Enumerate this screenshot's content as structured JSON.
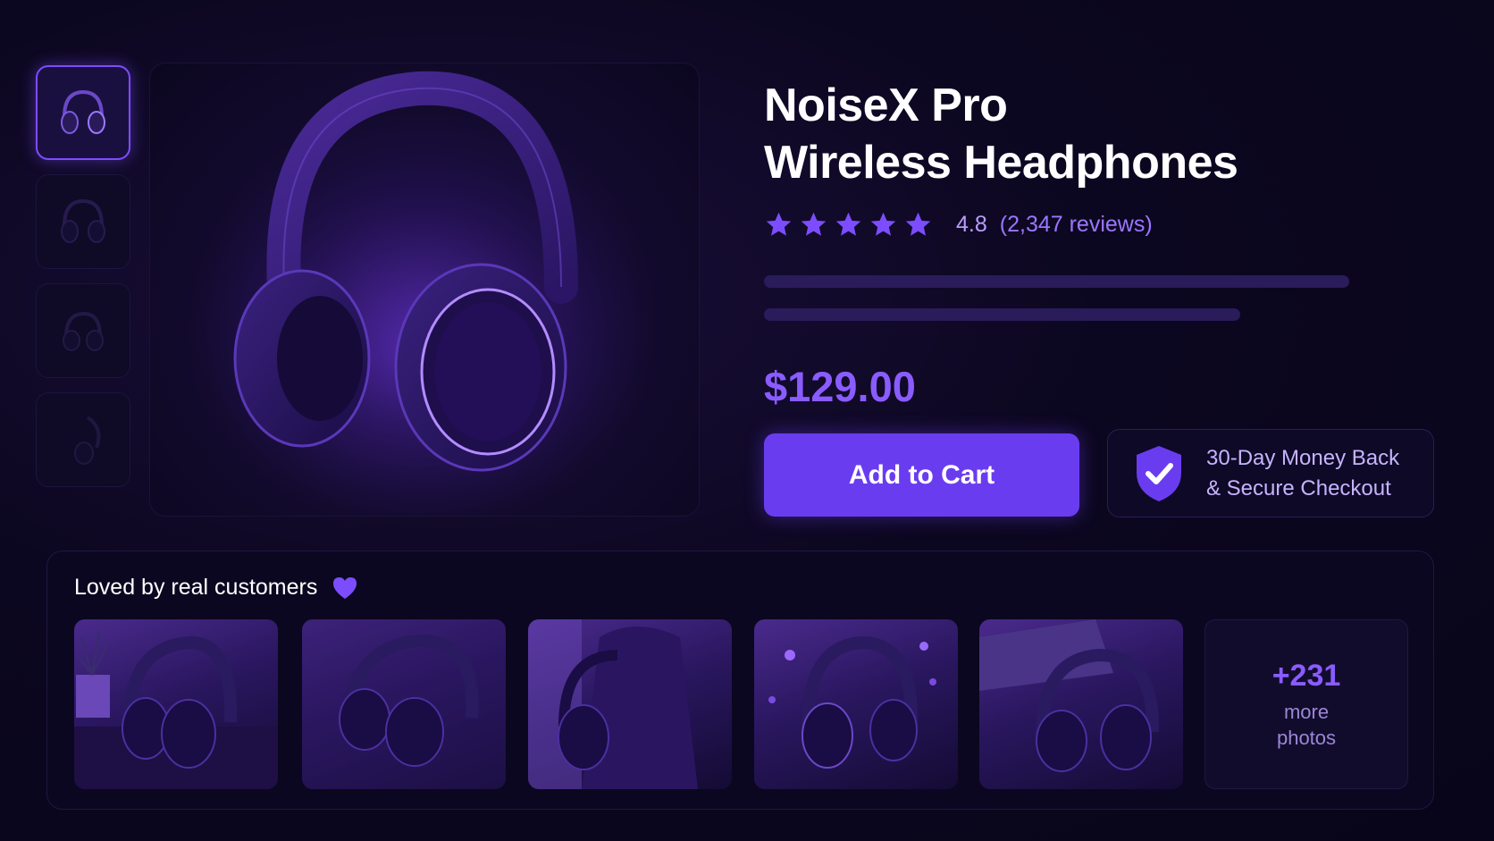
{
  "product": {
    "title_line1": "NoiseX Pro",
    "title_line2": "Wireless Headphones",
    "rating": "4.8",
    "rating_fraction": 0.96,
    "stars_total": 5,
    "review_count": "(2,347 reviews)",
    "price": "$129.00"
  },
  "actions": {
    "add_to_cart": "Add to Cart"
  },
  "guarantee": {
    "line1": "30-Day Money Back",
    "line2": "& Secure Checkout",
    "icon": "shield-check-icon"
  },
  "gallery": {
    "thumbnail_count": 4,
    "active_index": 0,
    "main_image": "headphones-product-image"
  },
  "customer_photos": {
    "title": "Loved by real customers",
    "title_icon": "heart-icon",
    "photos": [
      "headphones-on-desk-with-plant",
      "headphones-on-table",
      "headphones-on-backpack",
      "headphones-with-bokeh-lights",
      "headphones-by-laptop"
    ],
    "more_count": "+231",
    "more_label_line1": "more",
    "more_label_line2": "photos"
  },
  "colors": {
    "background": "#0a0618",
    "accent": "#6a3cf0",
    "accent_light": "#8a5cff",
    "star": "#7c4dff"
  }
}
